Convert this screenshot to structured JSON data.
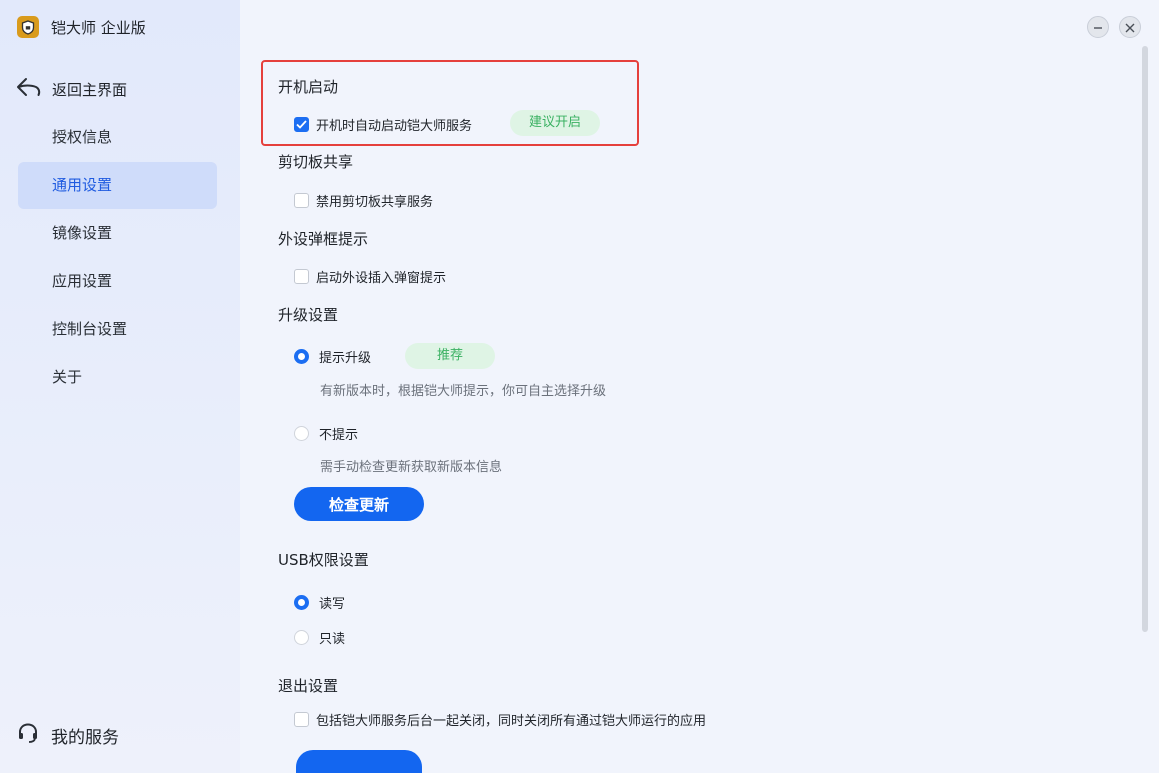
{
  "app": {
    "title": "铠大师 企业版",
    "logo_icon": "shield-icon"
  },
  "sidebar": {
    "back_label": "返回主界面",
    "items": [
      {
        "label": "授权信息",
        "active": false
      },
      {
        "label": "通用设置",
        "active": true
      },
      {
        "label": "镜像设置",
        "active": false
      },
      {
        "label": "应用设置",
        "active": false
      },
      {
        "label": "控制台设置",
        "active": false
      },
      {
        "label": "关于",
        "active": false
      }
    ],
    "service_label": "我的服务"
  },
  "settings": {
    "startup": {
      "title": "开机启动",
      "option_label": "开机时自动启动铠大师服务",
      "checked": true,
      "badge": "建议开启"
    },
    "clipboard": {
      "title": "剪切板共享",
      "option_label": "禁用剪切板共享服务",
      "checked": false
    },
    "peripheral": {
      "title": "外设弹框提示",
      "option_label": "启动外设插入弹窗提示",
      "checked": false
    },
    "upgrade": {
      "title": "升级设置",
      "options": [
        {
          "label": "提示升级",
          "selected": true,
          "badge": "推荐",
          "hint": "有新版本时，根据铠大师提示，你可自主选择升级"
        },
        {
          "label": "不提示",
          "selected": false,
          "hint": "需手动检查更新获取新版本信息"
        }
      ],
      "check_button": "检查更新"
    },
    "usb": {
      "title": "USB权限设置",
      "options": [
        {
          "label": "读写",
          "selected": true
        },
        {
          "label": "只读",
          "selected": false
        }
      ]
    },
    "exit": {
      "title": "退出设置",
      "option_label": "包括铠大师服务后台一起关闭，同时关闭所有通过铠大师运行的应用",
      "checked": false
    }
  },
  "colors": {
    "accent": "#1366f0",
    "active_nav_bg": "#cfdcfa",
    "badge_bg": "#dff4e5",
    "badge_text": "#3ab162",
    "highlight": "#e5403c"
  }
}
